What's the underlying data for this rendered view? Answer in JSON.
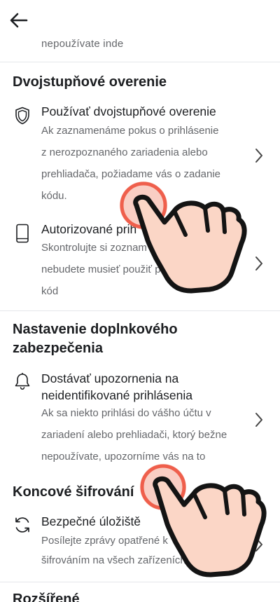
{
  "header": {
    "back_icon": "arrow-left-icon"
  },
  "partial_top_text": "nepoužívate inde",
  "sections": {
    "two_step": {
      "heading": "Dvojstupňové overenie",
      "items": [
        {
          "icon": "shield-icon",
          "title": "Používať dvojstupňové overenie",
          "desc": [
            "Ak zaznamenáme pokus o prihlásenie",
            "z nerozpoznaného zariadenia alebo",
            "prehliadača, požiadame vás o zadanie",
            "kódu."
          ]
        },
        {
          "icon": "phone-icon",
          "title": "Autorizované prih",
          "desc": [
            "Skontrolujte si zoznam",
            "nebudete musieť použiť p",
            "kód"
          ]
        }
      ]
    },
    "extra_security": {
      "heading_line1": "Nastavenie doplnkového",
      "heading_line2": "zabezpečenia",
      "items": [
        {
          "icon": "bell-icon",
          "title_line1": "Dostávať upozornenia na",
          "title_line2": "neidentifikované prihlásenia",
          "desc": [
            "Ak sa niekto prihlási do vášho účtu v",
            "zariadení alebo prehliadači, ktorý bežne",
            "nepoužívate, upozorníme vás na to"
          ]
        }
      ]
    },
    "encryption": {
      "heading": "Koncové šifrování",
      "items": [
        {
          "icon": "sync-icon",
          "title": "Bezpečné úložiště",
          "desc": [
            "Posílejte zprávy opatřené k",
            "šifrováním na všech zařízeních"
          ]
        }
      ]
    },
    "advanced": {
      "heading": "Rozšířené"
    }
  },
  "overlay": {
    "tap_indicator_icon": "tap-hand-icon",
    "accent_color": "#f26b5b"
  }
}
